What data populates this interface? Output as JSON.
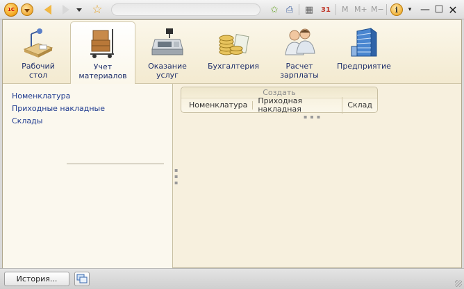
{
  "titlebar": {
    "logo_text": "1С",
    "memory_buttons": [
      "M",
      "M+",
      "M−"
    ]
  },
  "sections": [
    {
      "label": "Рабочий\nстол",
      "icon": "desk-icon",
      "active": false
    },
    {
      "label": "Учет\nматериалов",
      "icon": "boxes-cart-icon",
      "active": true
    },
    {
      "label": "Оказание\nуслуг",
      "icon": "cash-register-icon",
      "active": false
    },
    {
      "label": "Бухгалтерия",
      "icon": "coins-icon",
      "active": false
    },
    {
      "label": "Расчет\nзарплаты",
      "icon": "people-icon",
      "active": false
    },
    {
      "label": "Предприятие",
      "icon": "building-icon",
      "active": false
    }
  ],
  "navigation": {
    "items": [
      "Номенклатура",
      "Приходные накладные",
      "Склады"
    ]
  },
  "create_panel": {
    "title": "Создать",
    "items": [
      "Номенклатура",
      "Приходная накладная",
      "Склад"
    ]
  },
  "statusbar": {
    "history_label": "История..."
  },
  "colors": {
    "link": "#1e3a8f",
    "section_label": "#1f2f6b",
    "panel_bg": "#f7f0de"
  }
}
